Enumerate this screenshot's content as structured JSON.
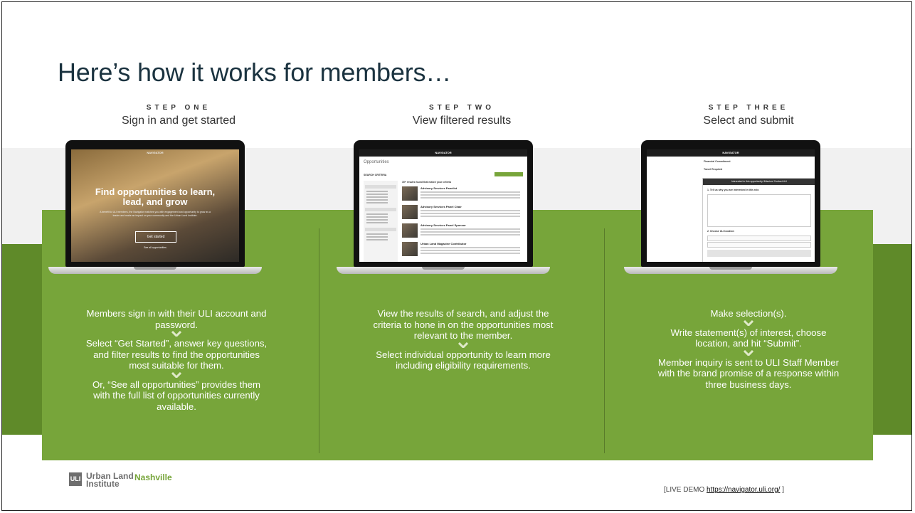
{
  "slide": {
    "title": "Here’s how it works for members…",
    "colors": {
      "green": "#77a53a",
      "dark_green": "#5f8a29",
      "title": "#1b3340"
    }
  },
  "steps": [
    {
      "label": "STEP ONE",
      "subtitle": "Sign in and get started",
      "paragraphs": [
        "Members sign in with their ULI account and password.",
        "Select “Get Started”, answer key questions, and filter results to find the opportunities most suitable for them.",
        "Or, “See all opportunities” provides them with the full list of opportunities currently available."
      ]
    },
    {
      "label": "STEP TWO",
      "subtitle": "View filtered results",
      "paragraphs": [
        "View the results of search, and adjust the criteria to hone in on the opportunities most relevant to the member.",
        "Select individual opportunity to learn more including eligibility requirements."
      ]
    },
    {
      "label": "STEP THREE",
      "subtitle": "Select and submit",
      "paragraphs": [
        "Make selection(s).",
        "Write statement(s) of interest, choose location, and hit “Submit”.",
        "Member inquiry is sent to ULI Staff Member with the brand promise of a response within three business days."
      ]
    }
  ],
  "screen1": {
    "nav": "NAVIGATOR",
    "heading": "Find opportunities to learn, lead, and grow",
    "body": "A benefit to ULI members, the Navigator matches you with engagement and opportunity to grow as a leader and make an impact on your community and the Urban Land Institute.",
    "button": "Get started",
    "link": "See all opportunities"
  },
  "screen2": {
    "nav": "NAVIGATOR",
    "page_title": "Opportunities",
    "search_criteria": "SEARCH CRITERIA",
    "results_title": "30+ results found that match your criteria",
    "results": [
      "Advisory Services Panelist",
      "Advisory Services Panel Chair",
      "Advisory Services Panel Sponsor",
      "Urban Land Magazine Contributor"
    ]
  },
  "screen3": {
    "nav": "NAVIGATOR",
    "fields": [
      "Financial Commitment",
      "Travel Required"
    ],
    "modal_title": "Interested in this opportunity /Mission/ Contact ULI",
    "q1": "1. Tell us why you are interested in this role.",
    "q2": "2. Choose ULI location"
  },
  "logo": {
    "mark": "ULI",
    "line1": "Urban Land",
    "line2": "Institute",
    "nashville": "Nashville"
  },
  "demo": {
    "prefix": "[LIVE DEMO ",
    "url": "https://navigator.uli.org/",
    "suffix": " ]"
  }
}
